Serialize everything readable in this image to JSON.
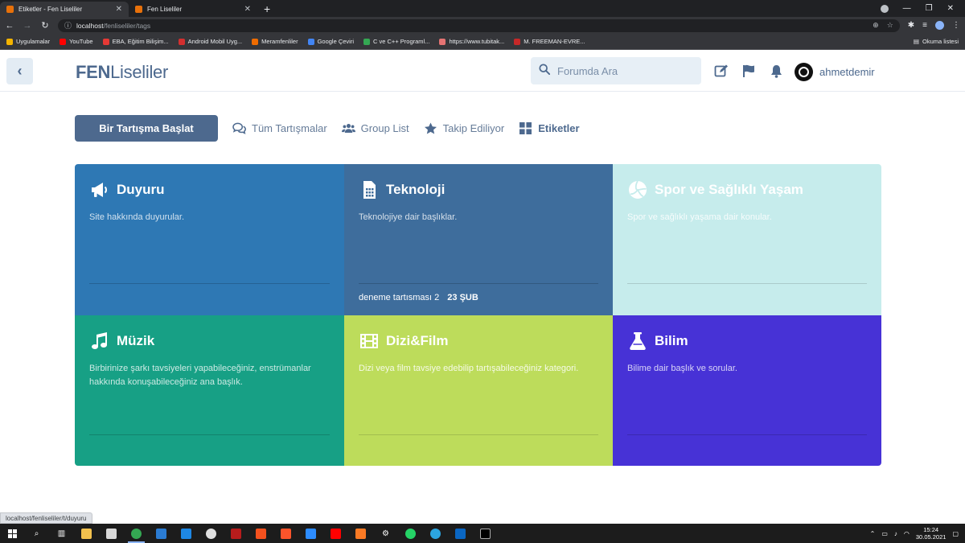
{
  "browser": {
    "tabs": [
      {
        "title": "Etiketler - Fen Liseliler",
        "active": true
      },
      {
        "title": "Fen Liseliler",
        "active": false
      }
    ],
    "url_host": "localhost",
    "url_path": "/fenliseliler/tags",
    "bookmarks": [
      {
        "label": "Uygulamalar",
        "color": "#f4b400"
      },
      {
        "label": "YouTube",
        "color": "#ff0000"
      },
      {
        "label": "EBA, Eğitim Bilişim...",
        "color": "#e53935"
      },
      {
        "label": "Android Mobil Uyg...",
        "color": "#d32f2f"
      },
      {
        "label": "Meramfenliler",
        "color": "#ef6c00"
      },
      {
        "label": "Google Çeviri",
        "color": "#4285f4"
      },
      {
        "label": "C ve C++ Programl...",
        "color": "#34a853"
      },
      {
        "label": "https://www.tubitak...",
        "color": "#e57373"
      },
      {
        "label": "M. FREEMAN-EVRE...",
        "color": "#c62828"
      }
    ],
    "reading_list": "Okuma listesi",
    "status_url": "localhost/fenliseliler/t/duyuru"
  },
  "header": {
    "logo_bold": "FEN",
    "logo_rest": "Liseliler",
    "search_placeholder": "Forumda Ara",
    "username": "ahmetdemir"
  },
  "toolbar": {
    "start_discussion": "Bir Tartışma Başlat",
    "nav": [
      {
        "label": "Tüm Tartışmalar",
        "icon": "comments-icon",
        "active": false
      },
      {
        "label": "Group List",
        "icon": "users-icon",
        "active": false
      },
      {
        "label": "Takip Ediliyor",
        "icon": "star-icon",
        "active": false
      },
      {
        "label": "Etiketler",
        "icon": "grid-icon",
        "active": true
      }
    ]
  },
  "tags": [
    {
      "title": "Duyuru",
      "icon": "megaphone-icon",
      "description": "Site hakkında duyurular.",
      "color": "#2e78b4",
      "last_title": "",
      "last_date": ""
    },
    {
      "title": "Teknoloji",
      "icon": "sim-card-icon",
      "description": "Teknolojiye dair başlıklar.",
      "color": "#3e6d9c",
      "last_title": "deneme tartısması 2",
      "last_date": "23 ŞUB"
    },
    {
      "title": "Spor ve Sağlıklı Yaşam",
      "icon": "volleyball-icon",
      "description": "Spor ve sağlıklı yaşama dair konular.",
      "color": "#c6ecec",
      "last_title": "",
      "last_date": ""
    },
    {
      "title": "Müzik",
      "icon": "music-icon",
      "description": "Birbirinize şarkı tavsiyeleri yapabileceğiniz, enstrümanlar hakkında konuşabileceğiniz ana başlık.",
      "color": "#17a085",
      "last_title": "",
      "last_date": ""
    },
    {
      "title": "Dizi&Film",
      "icon": "film-icon",
      "description": "Dizi veya film tavsiye edebilip tartışabileceğiniz kategori.",
      "color": "#bddc5b",
      "last_title": "",
      "last_date": ""
    },
    {
      "title": "Bilim",
      "icon": "flask-icon",
      "description": "Bilime dair başlık ve sorular.",
      "color": "#4732d6",
      "last_title": "",
      "last_date": ""
    }
  ],
  "taskbar": {
    "time": "15:24",
    "date": "30.05.2021"
  }
}
